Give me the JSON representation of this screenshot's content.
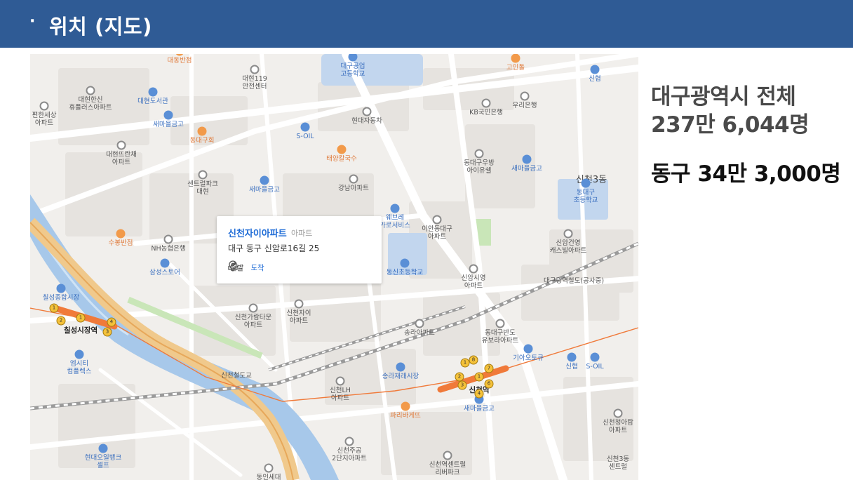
{
  "header": {
    "bullet": "·",
    "title": "위치 (지도)"
  },
  "colors": {
    "header_bg": "#2f5b95",
    "water": "#a7c8ea",
    "park": "#c9e6b8",
    "subway_line": "#f07a3a",
    "road": "#ffffff",
    "railway": "#9a9a9a"
  },
  "popup": {
    "name": "신천자이아파트",
    "category": "아파트",
    "address": "대구 동구 신암로16길 25",
    "depart_label": "출발",
    "arrive_label": "도착",
    "share_icon": "share-icon",
    "location_icon": "map-pin-icon"
  },
  "stats": {
    "city_line1": "대구광역시 전체",
    "city_line2": "237만 6,044명",
    "dong_line": "동구 34만 3,000명"
  },
  "map_labels": [
    {
      "text": "대동반점",
      "cls": "orange",
      "icon": "restaurant-icon"
    },
    {
      "text": "대구공업\n고등학교",
      "cls": "blue",
      "icon": "school-icon"
    },
    {
      "text": "고인돌",
      "cls": "orange",
      "icon": "restaurant-icon"
    },
    {
      "text": "신협",
      "cls": "blue",
      "icon": "bank-icon"
    },
    {
      "text": "대현119\n안전센터",
      "cls": "",
      "icon": "fire-station-icon"
    },
    {
      "text": "대현한신\n휴플러스아파트",
      "cls": "",
      "icon": "apartment-icon"
    },
    {
      "text": "대현도서관",
      "cls": "blue",
      "icon": "library-icon"
    },
    {
      "text": "편한세상\n아파트",
      "cls": "",
      "icon": "apartment-icon"
    },
    {
      "text": "새마을금고",
      "cls": "blue",
      "icon": "bank-icon"
    },
    {
      "text": "KB국민은행",
      "cls": "",
      "icon": "bank-icon"
    },
    {
      "text": "우리은행",
      "cls": "",
      "icon": "bank-icon"
    },
    {
      "text": "현대자동차",
      "cls": "",
      "icon": "car-dealer-icon"
    },
    {
      "text": "동대구회",
      "cls": "orange",
      "icon": "restaurant-icon"
    },
    {
      "text": "S-OIL",
      "cls": "blue",
      "icon": "gas-station-icon"
    },
    {
      "text": "대현뜨란채\n아파트",
      "cls": "",
      "icon": "apartment-icon"
    },
    {
      "text": "태양칼국수",
      "cls": "orange",
      "icon": "restaurant-icon"
    },
    {
      "text": "동대구우방\n아이유쉘",
      "cls": "",
      "icon": "apartment-icon"
    },
    {
      "text": "새마을금고",
      "cls": "blue",
      "icon": "bank-icon"
    },
    {
      "text": "센트럴파크\n대현",
      "cls": "",
      "icon": "apartment-icon"
    },
    {
      "text": "새마을금고",
      "cls": "blue",
      "icon": "bank-icon"
    },
    {
      "text": "강남아파트",
      "cls": "",
      "icon": "apartment-icon"
    },
    {
      "text": "신천3동",
      "cls": "area",
      "icon": ""
    },
    {
      "text": "동대구\n초등학교",
      "cls": "blue",
      "icon": "school-icon"
    },
    {
      "text": "웨브레\n카로서비스",
      "cls": "blue",
      "icon": "car-service-icon"
    },
    {
      "text": "이안동대구\n아파트",
      "cls": "",
      "icon": "apartment-icon"
    },
    {
      "text": "신암건영\n캐스빌아파트",
      "cls": "",
      "icon": "apartment-icon"
    },
    {
      "text": "수봉반점",
      "cls": "orange",
      "icon": "restaurant-icon"
    },
    {
      "text": "NH농협은행",
      "cls": "",
      "icon": "bank-icon"
    },
    {
      "text": "동신초등학교",
      "cls": "blue",
      "icon": "school-icon"
    },
    {
      "text": "신암시영\n아파트",
      "cls": "",
      "icon": "apartment-icon"
    },
    {
      "text": "삼성스토어",
      "cls": "blue",
      "icon": "store-icon"
    },
    {
      "text": "칠성종합시장",
      "cls": "blue",
      "icon": "market-icon"
    },
    {
      "text": "신천자이\n아파트",
      "cls": "",
      "icon": "apartment-icon"
    },
    {
      "text": "신천가람타운\n아파트",
      "cls": "",
      "icon": "apartment-icon"
    },
    {
      "text": "칠성시장역",
      "cls": "dark",
      "icon": ""
    },
    {
      "text": "송라아파트",
      "cls": "",
      "icon": "apartment-icon"
    },
    {
      "text": "동대구반도\n유보라아파트",
      "cls": "",
      "icon": "apartment-icon"
    },
    {
      "text": "기아오토큐",
      "cls": "blue",
      "icon": "car-service-icon"
    },
    {
      "text": "신협",
      "cls": "blue",
      "icon": "bank-icon"
    },
    {
      "text": "S-OIL",
      "cls": "blue",
      "icon": "gas-station-icon"
    },
    {
      "text": "엠시티\n컴플렉스",
      "cls": "blue",
      "icon": "building-icon"
    },
    {
      "text": "신천철도교",
      "cls": "",
      "icon": ""
    },
    {
      "text": "신천LH\n아파트",
      "cls": "",
      "icon": "apartment-icon"
    },
    {
      "text": "송라재래시장",
      "cls": "blue",
      "icon": "market-icon"
    },
    {
      "text": "신천역",
      "cls": "dark",
      "icon": ""
    },
    {
      "text": "새마을금고",
      "cls": "blue",
      "icon": "bank-icon"
    },
    {
      "text": "파리바게뜨",
      "cls": "orange",
      "icon": "bakery-icon"
    },
    {
      "text": "신천청아람\n아파트",
      "cls": "",
      "icon": "apartment-icon"
    },
    {
      "text": "신천주공\n2단지아파트",
      "cls": "",
      "icon": "apartment-icon"
    },
    {
      "text": "신천역센트럴\n리버파크",
      "cls": "",
      "icon": "apartment-icon"
    },
    {
      "text": "현대오일뱅크\n셀프",
      "cls": "blue",
      "icon": "gas-station-icon"
    },
    {
      "text": "신천3동\n센트럴",
      "cls": "",
      "icon": ""
    },
    {
      "text": "동인세대",
      "cls": "",
      "icon": "apartment-icon"
    },
    {
      "text": "대구광역철도(공사중)",
      "cls": "",
      "icon": ""
    }
  ],
  "station_exits": [
    "1",
    "2",
    "3",
    "4",
    "5",
    "6",
    "7",
    "8"
  ]
}
